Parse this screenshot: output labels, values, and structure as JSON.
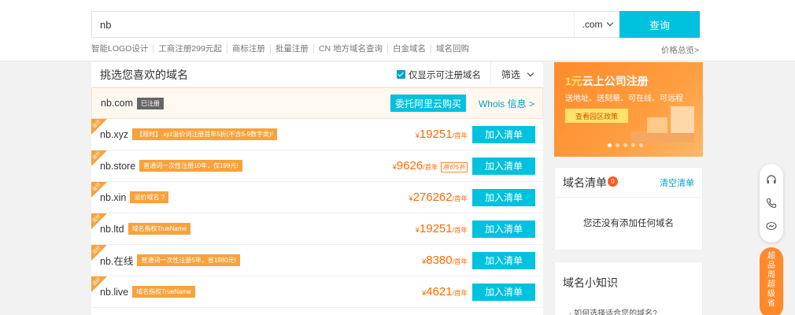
{
  "search": {
    "value": "nb",
    "suffix": ".com",
    "button": "查询"
  },
  "quick_links": [
    "智能LOGO设计",
    "工商注册299元起",
    "商标注册",
    "批量注册",
    "CN 地方域名查询",
    "白金域名",
    "域名回购"
  ],
  "price_link": "价格总览>",
  "list": {
    "title": "挑选您喜欢的域名",
    "available_only": "仅显示可注册域名",
    "filter": "筛选",
    "featured": {
      "domain": "nb.com",
      "tag": "已注册",
      "entrust": "委托阿里云购买",
      "whois": "Whois 信息 >"
    },
    "rows": [
      {
        "domain": "nb.xyz",
        "tag": "【限时】.xyz溢价词注册首年5折(不含6-9数字类)!",
        "currency": "¥",
        "price": "19251",
        "unit": "/首年",
        "renew": "",
        "button": "加入清单"
      },
      {
        "domain": "nb.store",
        "tag": "普通词一次性注册10年，仅199元!",
        "currency": "¥",
        "price": "9626",
        "unit": "/首年",
        "renew": "原价5折",
        "button": "加入清单"
      },
      {
        "domain": "nb.xin",
        "tag": "溢价域名 ?",
        "currency": "¥",
        "price": "276262",
        "unit": "/首年",
        "renew": "",
        "button": "加入清单"
      },
      {
        "domain": "nb.ltd",
        "tag": "域名指权TrueName",
        "currency": "¥",
        "price": "19251",
        "unit": "/首年",
        "renew": "",
        "button": "加入清单"
      },
      {
        "domain": "nb.在线",
        "tag": "普通词一次性注册5年，省1980元!",
        "currency": "¥",
        "price": "8380",
        "unit": "/首年",
        "renew": "",
        "button": "加入清单"
      },
      {
        "domain": "nb.live",
        "tag": "域名指权TrueName",
        "currency": "¥",
        "price": "4621",
        "unit": "/首年",
        "renew": "",
        "button": "加入清单"
      }
    ],
    "corner_label": "溢价"
  },
  "banner": {
    "title_highlight": "1元",
    "title": "云上公司注册",
    "subtitle": "送地址、送刻章、可在线、可远程",
    "button": "查看园区政策"
  },
  "cart": {
    "title": "域名清单",
    "count": "0",
    "clear": "清空清单",
    "empty": "您还没有添加任何域名"
  },
  "knowledge": {
    "title": "域名小知识",
    "item": "· 如何选择适合您的域名?"
  },
  "promo": [
    "超",
    "品",
    "周",
    "超",
    "级",
    "省"
  ],
  "colors": {
    "accent": "#00c1de",
    "price": "#ff6a00",
    "tag": "#f7a23b"
  }
}
